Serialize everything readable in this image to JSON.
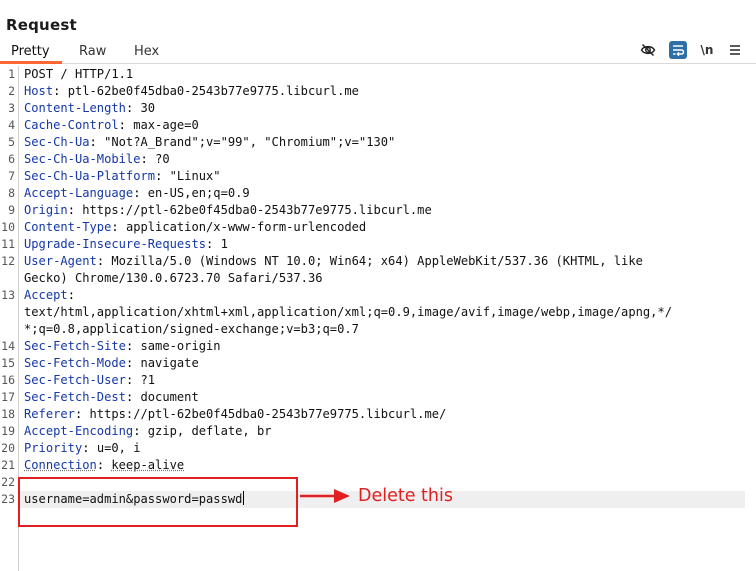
{
  "panel": {
    "title": "Request"
  },
  "tabs": [
    {
      "label": "Pretty",
      "active": true
    },
    {
      "label": "Raw",
      "active": false
    },
    {
      "label": "Hex",
      "active": false
    }
  ],
  "toolbar": {
    "icons": [
      "eye-slash-icon",
      "wrap-lines-icon",
      "newline-icon",
      "menu-icon"
    ],
    "newline_label": "\\n"
  },
  "colors": {
    "tab_accent": "#ff6633",
    "annotation": "#e02020",
    "header_key": "#1537a8"
  },
  "request": {
    "lines": [
      {
        "n": "1",
        "text": "POST / HTTP/1.1"
      },
      {
        "n": "2",
        "key": "Host",
        "value": "ptl-62be0f45dba0-2543b77e9775.libcurl.me"
      },
      {
        "n": "3",
        "key": "Content-Length",
        "value": "30"
      },
      {
        "n": "4",
        "key": "Cache-Control",
        "value": "max-age=0"
      },
      {
        "n": "5",
        "key": "Sec-Ch-Ua",
        "value": "\"Not?A_Brand\";v=\"99\", \"Chromium\";v=\"130\""
      },
      {
        "n": "6",
        "key": "Sec-Ch-Ua-Mobile",
        "value": "?0"
      },
      {
        "n": "7",
        "key": "Sec-Ch-Ua-Platform",
        "value": "\"Linux\""
      },
      {
        "n": "8",
        "key": "Accept-Language",
        "value": "en-US,en;q=0.9"
      },
      {
        "n": "9",
        "key": "Origin",
        "value": "https://ptl-62be0f45dba0-2543b77e9775.libcurl.me"
      },
      {
        "n": "10",
        "key": "Content-Type",
        "value": "application/x-www-form-urlencoded"
      },
      {
        "n": "11",
        "key": "Upgrade-Insecure-Requests",
        "value": "1"
      },
      {
        "n": "12",
        "key": "User-Agent",
        "value": "Mozilla/5.0 (Windows NT 10.0; Win64; x64) AppleWebKit/537.36 (KHTML, like"
      },
      {
        "n": "",
        "text": "Gecko) Chrome/130.0.6723.70 Safari/537.36"
      },
      {
        "n": "13",
        "key": "Accept",
        "value": ""
      },
      {
        "n": "",
        "text": "text/html,application/xhtml+xml,application/xml;q=0.9,image/avif,image/webp,image/apng,*/"
      },
      {
        "n": "",
        "text": "*;q=0.8,application/signed-exchange;v=b3;q=0.7"
      },
      {
        "n": "14",
        "key": "Sec-Fetch-Site",
        "value": "same-origin"
      },
      {
        "n": "15",
        "key": "Sec-Fetch-Mode",
        "value": "navigate"
      },
      {
        "n": "16",
        "key": "Sec-Fetch-User",
        "value": "?1"
      },
      {
        "n": "17",
        "key": "Sec-Fetch-Dest",
        "value": "document"
      },
      {
        "n": "18",
        "key": "Referer",
        "value": "https://ptl-62be0f45dba0-2543b77e9775.libcurl.me/"
      },
      {
        "n": "19",
        "key": "Accept-Encoding",
        "value": "gzip, deflate, br"
      },
      {
        "n": "20",
        "key": "Priority",
        "value": "u=0, i"
      },
      {
        "n": "21",
        "key": "Connection",
        "value": "keep-alive",
        "squiggle": true
      },
      {
        "n": "22",
        "text": ""
      },
      {
        "n": "23",
        "text": "username=admin&password=passwd",
        "current": true
      }
    ]
  },
  "annotation": {
    "label": "Delete this"
  }
}
